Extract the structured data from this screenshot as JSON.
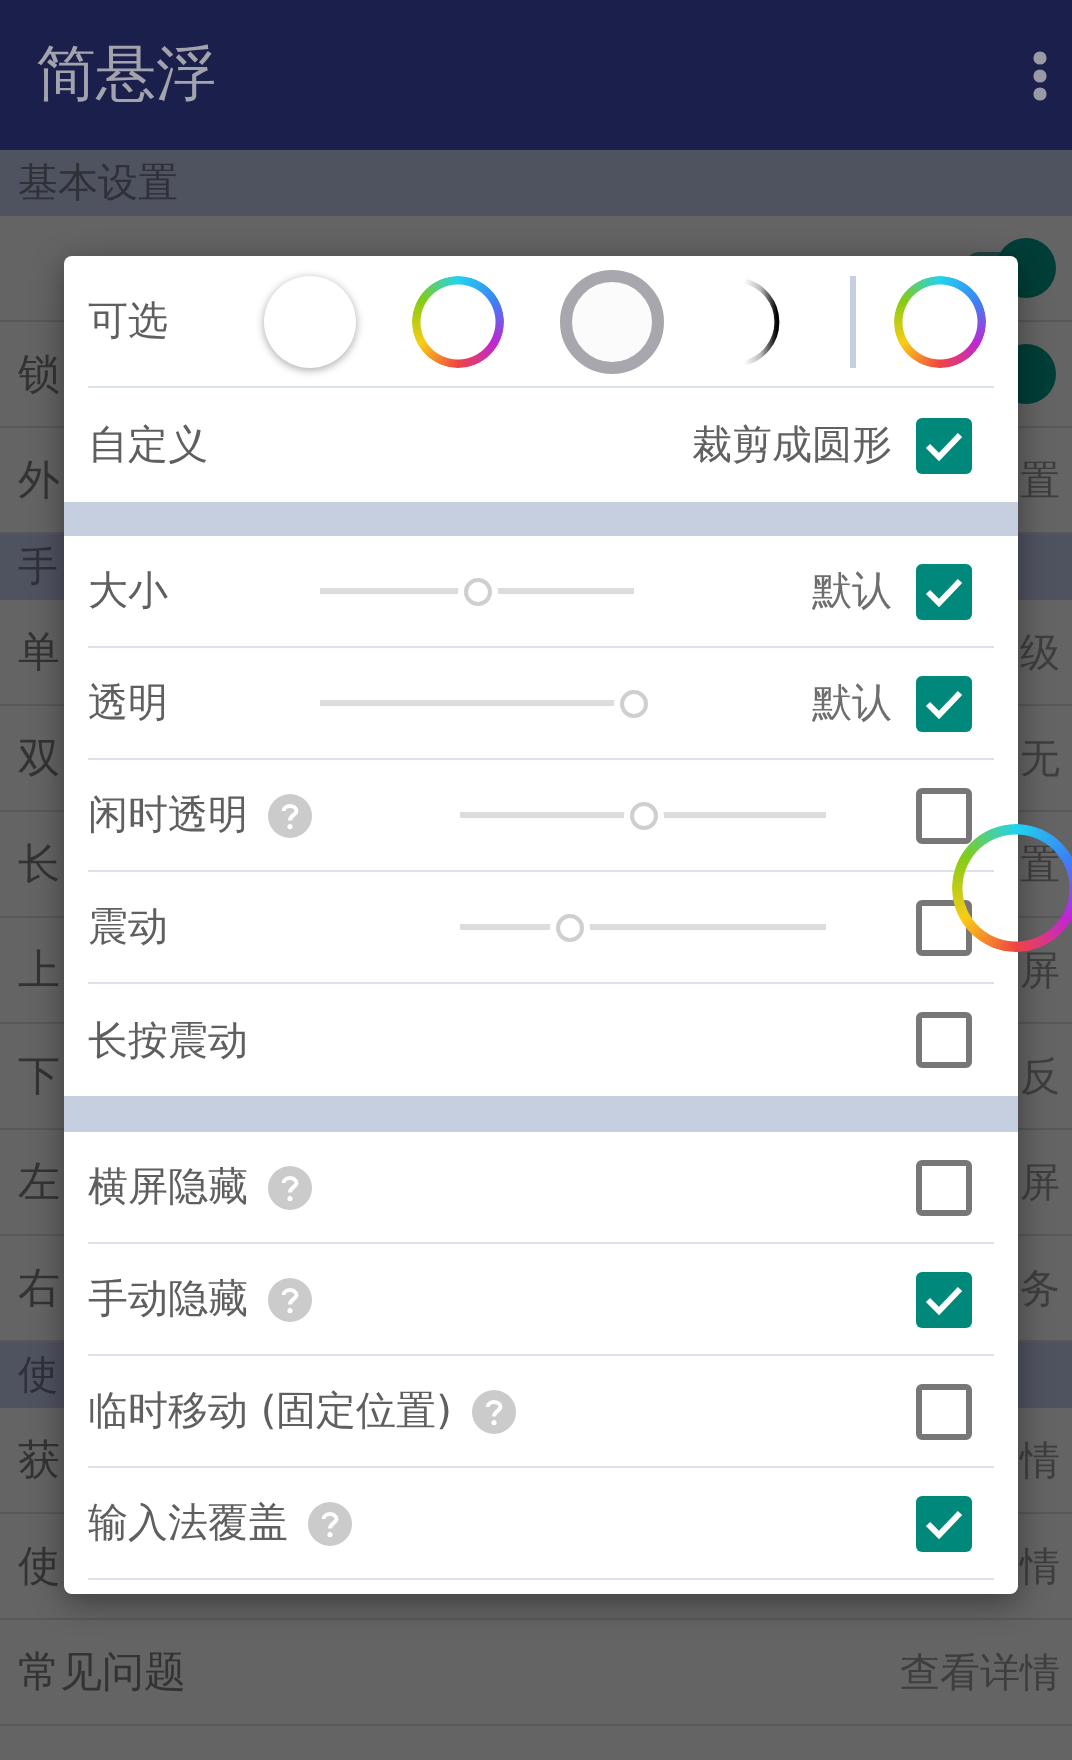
{
  "app_bar": {
    "title": "简悬浮"
  },
  "background": {
    "sections": [
      {
        "header": "基本设置",
        "rows": [
          {
            "toggle": true
          },
          {
            "label": "锁",
            "toggle": true
          },
          {
            "label": "外",
            "value": "置"
          }
        ]
      },
      {
        "header": "手",
        "rows": [
          {
            "label": "单",
            "value": "级"
          },
          {
            "label": "双",
            "value": "无"
          },
          {
            "label": "长",
            "value": "置"
          },
          {
            "label": "上",
            "value": "屏"
          },
          {
            "label": "下",
            "value": "反"
          },
          {
            "label": "左",
            "value": "屏"
          },
          {
            "label": "右",
            "value": "务"
          }
        ]
      },
      {
        "header": "使",
        "rows": [
          {
            "label": "获",
            "value": "情"
          },
          {
            "label": "使",
            "value": "情"
          },
          {
            "label": "常见问题",
            "value": "查看详情"
          }
        ]
      }
    ]
  },
  "dialog": {
    "style_row": {
      "label": "可选",
      "presets": [
        {
          "kind": "plain"
        },
        {
          "kind": "rainbow"
        },
        {
          "kind": "gray-ring"
        },
        {
          "kind": "crescent"
        }
      ],
      "current": {
        "kind": "rainbow"
      }
    },
    "custom_row": {
      "label": "自定义",
      "option": "裁剪成圆形",
      "checked": true
    },
    "groups": [
      {
        "rows": [
          {
            "label": "大小",
            "help": false,
            "kind": "slider",
            "level": 0.5,
            "default_label": "默认",
            "checked": true
          },
          {
            "label": "透明",
            "help": false,
            "kind": "slider",
            "level": 1,
            "default_label": "默认",
            "checked": true
          },
          {
            "label": "闲时透明",
            "help": true,
            "kind": "slider",
            "level": 0.5,
            "checked": false
          },
          {
            "label": "震动",
            "help": false,
            "kind": "slider",
            "level": 0.3,
            "checked": false
          },
          {
            "label": "长按震动",
            "help": false,
            "kind": "check",
            "checked": false
          }
        ]
      },
      {
        "rows": [
          {
            "label": "横屏隐藏",
            "help": true,
            "kind": "check",
            "checked": false
          },
          {
            "label": "手动隐藏",
            "help": true,
            "kind": "check",
            "checked": true
          },
          {
            "label": "临时移动 (固定位置)",
            "help": true,
            "kind": "check",
            "checked": false
          },
          {
            "label": "输入法覆盖",
            "help": true,
            "kind": "check",
            "checked": true
          }
        ]
      }
    ]
  }
}
